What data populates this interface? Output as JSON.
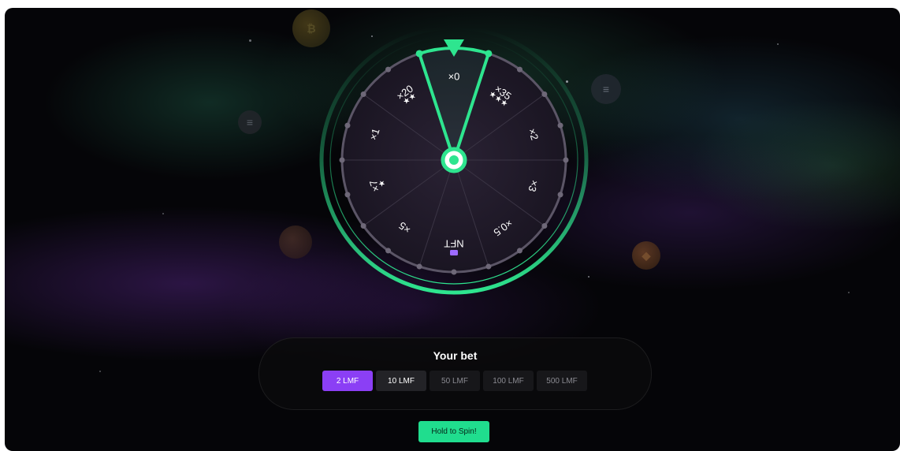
{
  "wheel": {
    "segments": [
      {
        "label": "×0",
        "stars": ""
      },
      {
        "label": "×35",
        "stars": "★★★"
      },
      {
        "label": "×2",
        "stars": ""
      },
      {
        "label": "×3",
        "stars": ""
      },
      {
        "label": "×0.5",
        "stars": ""
      },
      {
        "label": "NFT",
        "stars": ""
      },
      {
        "label": "×5",
        "stars": ""
      },
      {
        "label": "×7",
        "stars": "★"
      },
      {
        "label": "×1",
        "stars": ""
      },
      {
        "label": "×20",
        "stars": "★★"
      }
    ],
    "selected_segment": "×0",
    "accent_color": "#2ee58f",
    "nft_icon": "ticket-icon"
  },
  "bet": {
    "title": "Your bet",
    "options": [
      "2 LMF",
      "10 LMF",
      "50 LMF",
      "100 LMF",
      "500 LMF"
    ],
    "selected": "2 LMF",
    "selected_color": "#8b3ff5"
  },
  "spin": {
    "label": "Hold to Spin!",
    "color": "#20dd8e"
  },
  "decor": {
    "coin_icons": [
      "bitcoin-coin-icon",
      "solana-coin-icon",
      "solana-coin-icon",
      "coin-icon",
      "binance-coin-icon"
    ]
  }
}
